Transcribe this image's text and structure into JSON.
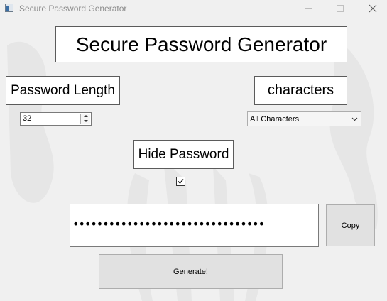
{
  "window": {
    "title": "Secure Password Generator",
    "controls": {
      "minimize_icon": "minimize-icon",
      "maximize_icon": "maximize-icon",
      "close_icon": "close-icon"
    }
  },
  "header": {
    "title": "Secure Password Generator"
  },
  "length": {
    "label": "Password Length",
    "value": "32"
  },
  "characters": {
    "label": "characters",
    "selected": "All Characters"
  },
  "hide": {
    "label": "Hide Password",
    "checked": true
  },
  "output": {
    "password_masked": "••••••••••••••••••••••••••••••••"
  },
  "buttons": {
    "copy": "Copy",
    "generate": "Generate!"
  },
  "colors": {
    "background": "#f0f0f0",
    "button": "#e1e1e1",
    "border": "#5b5b5b"
  }
}
